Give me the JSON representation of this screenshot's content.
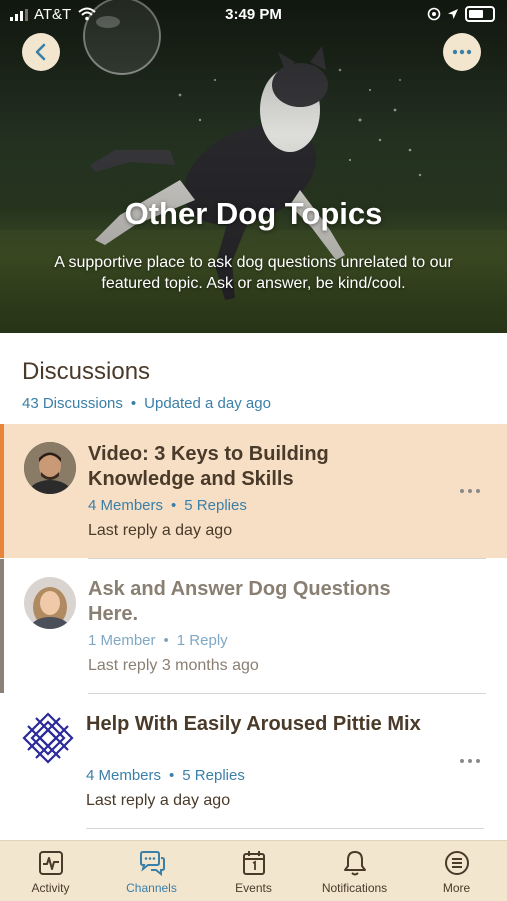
{
  "status_bar": {
    "carrier": "AT&T",
    "time": "3:49 PM"
  },
  "hero": {
    "title": "Other Dog Topics",
    "description": "A supportive place to ask dog questions unrelated to our featured topic. Ask or answer, be kind/cool."
  },
  "discussions": {
    "heading": "Discussions",
    "count_label": "43 Discussions",
    "updated_label": "Updated a day ago",
    "items": [
      {
        "title": "Video: 3 Keys to Building Knowledge and Skills",
        "members": "4 Members",
        "replies": "5 Replies",
        "last_reply": "Last reply a day ago",
        "state": "highlighted"
      },
      {
        "title": "Ask and Answer Dog Questions Here.",
        "members": "1 Member",
        "replies": "1 Reply",
        "last_reply": "Last reply 3 months ago",
        "state": "read"
      },
      {
        "title": "Help With Easily Aroused Pittie Mix",
        "members": "4 Members",
        "replies": "5 Replies",
        "last_reply": "Last reply a day ago",
        "state": "normal"
      }
    ]
  },
  "tabbar": {
    "tabs": [
      {
        "label": "Activity",
        "icon": "activity-icon"
      },
      {
        "label": "Channels",
        "icon": "chat-bubbles-icon",
        "active": true
      },
      {
        "label": "Events",
        "icon": "calendar-icon"
      },
      {
        "label": "Notifications",
        "icon": "bell-icon"
      },
      {
        "label": "More",
        "icon": "list-icon"
      }
    ]
  },
  "colors": {
    "accent": "#3a7fa8",
    "highlight_bg": "#f7dfc6",
    "highlight_bar": "#e8853a",
    "text_dark": "#4a3a2a",
    "tabbar_bg": "#f3e6cf"
  }
}
